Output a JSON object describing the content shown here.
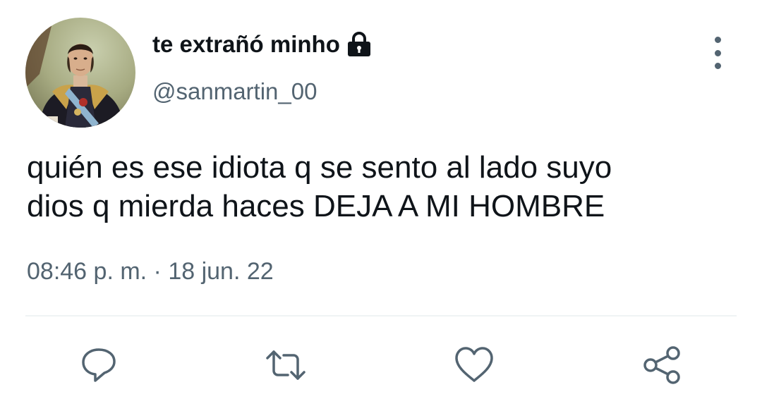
{
  "tweet": {
    "author": {
      "display_name": "te extrañó minho",
      "handle": "@sanmartin_00",
      "protected_icon": "lock-icon",
      "avatar": "portrait-avatar"
    },
    "text_lines": [
      "quién es ese idiota q se sento al lado suyo",
      "dios q mierda haces DEJA A MI HOMBRE"
    ],
    "timestamp": "08:46 p. m. · 18 jun. 22",
    "actions": [
      {
        "name": "reply",
        "icon": "reply-icon"
      },
      {
        "name": "retweet",
        "icon": "retweet-icon"
      },
      {
        "name": "like",
        "icon": "heart-icon"
      },
      {
        "name": "share",
        "icon": "share-icon"
      }
    ],
    "more_icon": "more-vertical-icon"
  },
  "colors": {
    "text_primary": "#0f1419",
    "text_secondary": "#536471",
    "divider": "#eff3f4",
    "background": "#ffffff"
  }
}
